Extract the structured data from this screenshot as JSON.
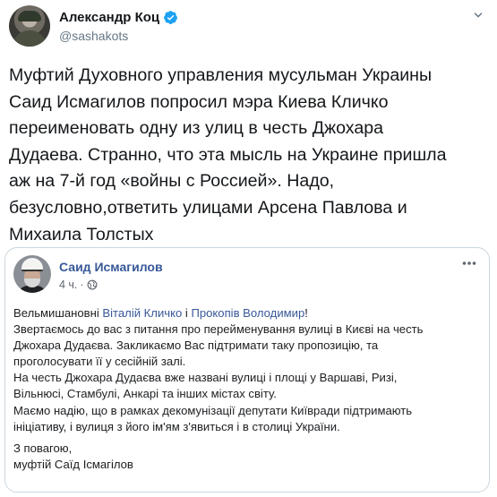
{
  "tweet": {
    "author_name": "Александр Коц",
    "author_handle": "@sashakots",
    "text": "Муфтий Духовного управления мусульман Украины\nСаид Исмагилов попросил мэра Киева Кличко\nпереименовать одну из улиц в честь Джохара\nДудаева. Странно, что эта мысль на Украине пришла\nаж на 7-й год «войны с Россией». Надо,\nбезусловно,ответить улицами Арсена Павлова и\nМихаила Толстых"
  },
  "fb_post": {
    "author_name": "Саид Исмагилов",
    "time": "4 ч.",
    "dot": "·",
    "greeting_prefix": "Вельмишановні ",
    "mention_1": "Віталій Кличко",
    "greeting_and": " і ",
    "mention_2": "Прокопів Володимир",
    "greeting_suffix": "!",
    "body_lines": [
      "Звертаємось до вас з питання про перейменування вулиці в Києві на честь",
      "Джохара Дудаєва. Закликаємо Вас підтримати таку пропозицію, та",
      "проголосувати її у сесійній залі.",
      "На честь Джохара Дудаєва вже названі вулиці і площі у Варшаві, Ризі,",
      "Вільнюсі, Стамбулі, Анкарі та інших містах світу.",
      "Маємо надію, що в рамках декомунізації депутати Київради підтримають",
      "ініціативу, і вулиця з його ім'ям з'явиться і в столиці України."
    ],
    "closing_1": "З повагою,",
    "closing_2": "муфтій Саїд Ісмагілов"
  },
  "colors": {
    "link": "#385898",
    "verified": "#1da1f2",
    "secondary_text": "#657786"
  }
}
